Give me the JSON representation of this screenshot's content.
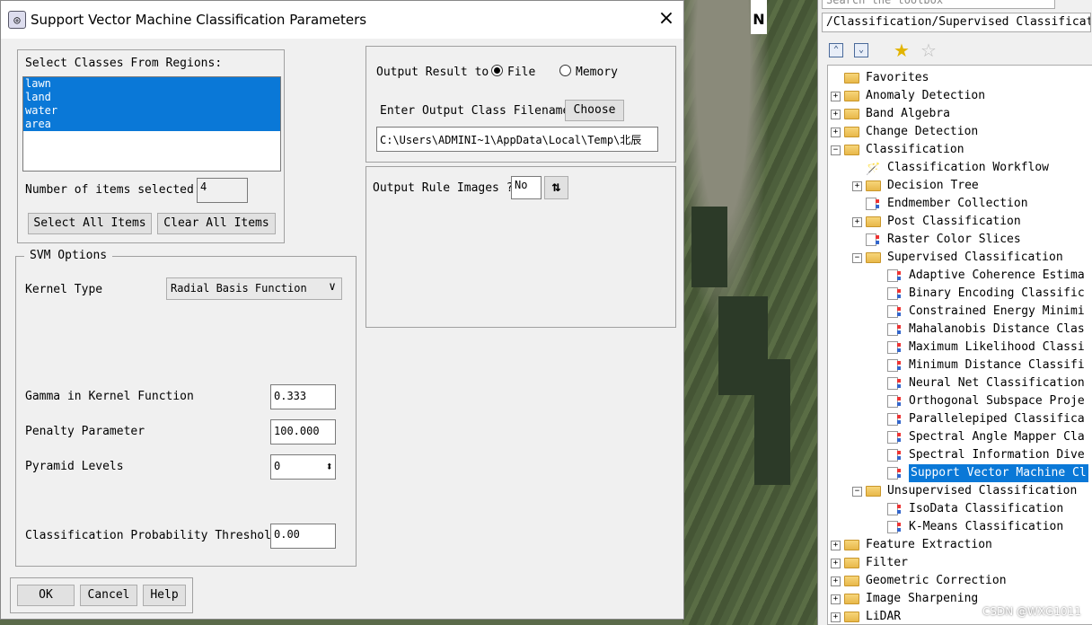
{
  "dialog": {
    "title": "Support Vector Machine Classification Parameters",
    "close": "×",
    "classes_label": "Select Classes From Regions:",
    "classes": [
      "lawn",
      "land",
      "water",
      "area"
    ],
    "num_selected_label": "Number of items selected:",
    "num_selected": "4",
    "select_all": "Select All Items",
    "clear_all": "Clear All Items",
    "svm_options_legend": "SVM Options",
    "kernel_type_label": "Kernel Type",
    "kernel_type_value": "Radial Basis Function",
    "gamma_label": "Gamma in Kernel Function",
    "gamma_value": "0.333",
    "penalty_label": "Penalty Parameter",
    "penalty_value": "100.000",
    "pyramid_label": "Pyramid Levels",
    "pyramid_value": "0",
    "prob_threshold_label": "Classification Probability Threshold",
    "prob_threshold_value": "0.00",
    "output_result_label": "Output Result to",
    "output_file": "File",
    "output_memory": "Memory",
    "output_selected": "File",
    "output_filename_label": "Enter Output Class Filename",
    "choose": "Choose",
    "output_path": "C:\\Users\\ADMINI~1\\AppData\\Local\\Temp\\北辰",
    "rule_images_label": "Output Rule Images ?",
    "rule_images_value": "No",
    "ok": "OK",
    "cancel": "Cancel",
    "help": "Help"
  },
  "map": {
    "north": "N"
  },
  "toolbox": {
    "search_placeholder": "Search the toolbox",
    "path": "/Classification/Supervised Classification",
    "tree": [
      {
        "label": "Favorites",
        "type": "folder",
        "level": 0,
        "expander": ""
      },
      {
        "label": "Anomaly Detection",
        "type": "folder",
        "level": 0,
        "expander": "+"
      },
      {
        "label": "Band Algebra",
        "type": "folder",
        "level": 0,
        "expander": "+"
      },
      {
        "label": "Change Detection",
        "type": "folder",
        "level": 0,
        "expander": "+"
      },
      {
        "label": "Classification",
        "type": "folder",
        "level": 0,
        "expander": "−"
      },
      {
        "label": "Classification Workflow",
        "type": "wand",
        "level": 1,
        "expander": ""
      },
      {
        "label": "Decision Tree",
        "type": "folder",
        "level": 1,
        "expander": "+"
      },
      {
        "label": "Endmember Collection",
        "type": "doc",
        "level": 1,
        "expander": ""
      },
      {
        "label": "Post Classification",
        "type": "folder",
        "level": 1,
        "expander": "+"
      },
      {
        "label": "Raster Color Slices",
        "type": "doc",
        "level": 1,
        "expander": ""
      },
      {
        "label": "Supervised Classification",
        "type": "folder",
        "level": 1,
        "expander": "−"
      },
      {
        "label": "Adaptive Coherence Estima",
        "type": "doc",
        "level": 2,
        "expander": ""
      },
      {
        "label": "Binary Encoding Classific",
        "type": "doc",
        "level": 2,
        "expander": ""
      },
      {
        "label": "Constrained Energy Minimi",
        "type": "doc",
        "level": 2,
        "expander": ""
      },
      {
        "label": "Mahalanobis Distance Clas",
        "type": "doc",
        "level": 2,
        "expander": ""
      },
      {
        "label": "Maximum Likelihood Classi",
        "type": "doc",
        "level": 2,
        "expander": ""
      },
      {
        "label": "Minimum Distance Classifi",
        "type": "doc",
        "level": 2,
        "expander": ""
      },
      {
        "label": "Neural Net Classification",
        "type": "doc",
        "level": 2,
        "expander": ""
      },
      {
        "label": "Orthogonal Subspace Proje",
        "type": "doc",
        "level": 2,
        "expander": ""
      },
      {
        "label": "Parallelepiped Classifica",
        "type": "doc",
        "level": 2,
        "expander": ""
      },
      {
        "label": "Spectral Angle Mapper Cla",
        "type": "doc",
        "level": 2,
        "expander": ""
      },
      {
        "label": "Spectral Information Dive",
        "type": "doc",
        "level": 2,
        "expander": ""
      },
      {
        "label": "Support Vector Machine Cl",
        "type": "doc",
        "level": 2,
        "expander": "",
        "selected": true
      },
      {
        "label": "Unsupervised Classification",
        "type": "folder",
        "level": 1,
        "expander": "−"
      },
      {
        "label": "IsoData Classification",
        "type": "doc",
        "level": 2,
        "expander": ""
      },
      {
        "label": "K-Means Classification",
        "type": "doc",
        "level": 2,
        "expander": ""
      },
      {
        "label": "Feature Extraction",
        "type": "folder",
        "level": 0,
        "expander": "+"
      },
      {
        "label": "Filter",
        "type": "folder",
        "level": 0,
        "expander": "+"
      },
      {
        "label": "Geometric Correction",
        "type": "folder",
        "level": 0,
        "expander": "+"
      },
      {
        "label": "Image Sharpening",
        "type": "folder",
        "level": 0,
        "expander": "+"
      },
      {
        "label": "LiDAR",
        "type": "folder",
        "level": 0,
        "expander": "+"
      }
    ]
  },
  "watermark": "CSDN @WXG1011"
}
